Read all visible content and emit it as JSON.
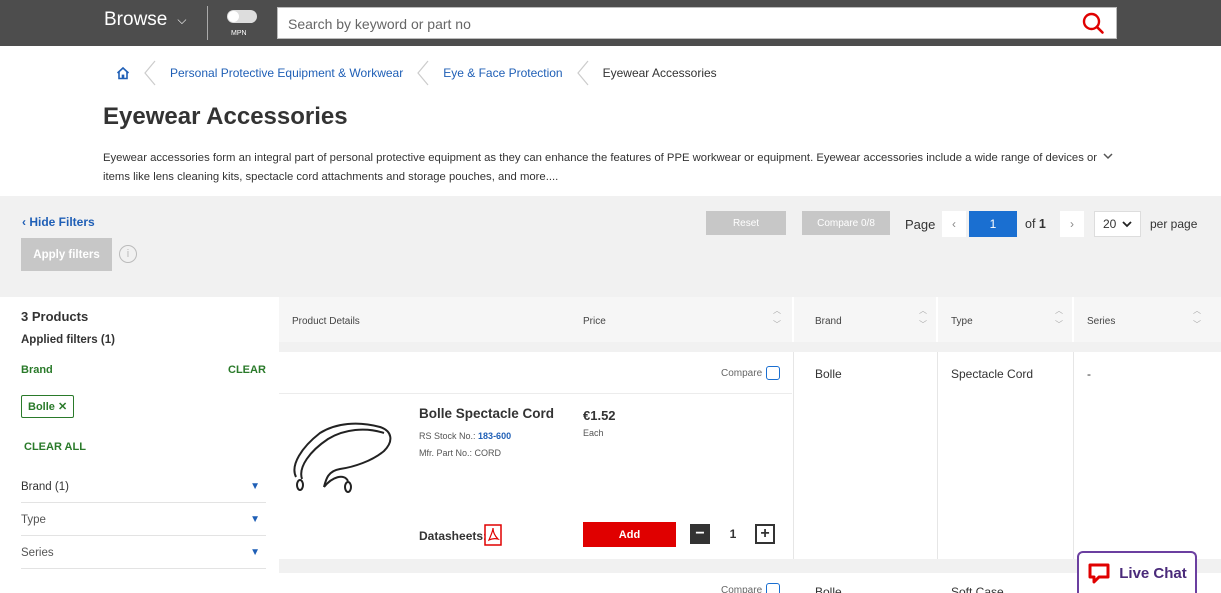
{
  "header": {
    "browse_label": "Browse",
    "mpn_label": "MPN",
    "search_placeholder": "Search by keyword or part no"
  },
  "breadcrumb": [
    "Personal Protective Equipment & Workwear",
    "Eye & Face Protection",
    "Eyewear Accessories"
  ],
  "page": {
    "title": "Eyewear Accessories",
    "description": "Eyewear accessories form an integral part of personal protective equipment as they can enhance the features of PPE workwear or equipment. Eyewear accessories include a wide range of devices or items like lens cleaning kits, spectacle cord attachments and storage pouches, and more...."
  },
  "filters": {
    "hide_label": "Hide Filters",
    "apply_label": "Apply filters",
    "products_count": "3 Products",
    "applied_label": "Applied filters (1)",
    "brand_label": "Brand",
    "clear_label": "CLEAR",
    "chip_label": "Bolle ✕",
    "clear_all_label": "CLEAR ALL",
    "facets": [
      "Brand (1)",
      "Type",
      "Series"
    ]
  },
  "toolbar": {
    "reset_label": "Reset",
    "compare_label": "Compare 0/8",
    "page_label": "Page",
    "current_page": "1",
    "of_label": "of",
    "total_pages": "1",
    "per_page_value": "20",
    "per_page_label": "per page"
  },
  "table": {
    "columns": [
      "Product Details",
      "Price",
      "Brand",
      "Type",
      "Series"
    ]
  },
  "products": [
    {
      "compare_label": "Compare",
      "name": "Bolle Spectacle Cord",
      "stock_label": "RS Stock No.:",
      "stock_no": "183-600",
      "mfr_label": "Mfr. Part No.:",
      "mfr_no": "CORD",
      "price": "€1.52",
      "unit": "Each",
      "datasheets_label": "Datasheets:",
      "add_label": "Add",
      "quantity": "1",
      "brand": "Bolle",
      "type": "Spectacle Cord",
      "series": "-"
    },
    {
      "compare_label": "Compare",
      "brand": "Bolle",
      "type": "Soft Case"
    }
  ],
  "live_chat": {
    "label": "Live Chat"
  },
  "icons": {
    "home": "home-icon",
    "search": "search-icon",
    "pdf": "pdf-icon",
    "chat": "chat-icon"
  },
  "colors": {
    "topbar": "#4d4d4d",
    "link": "#1f5fb6",
    "filter_green": "#2a7a2a",
    "add_red": "#e00000",
    "page_blue": "#1a6fd1",
    "chat_purple": "#6b3fa0"
  }
}
